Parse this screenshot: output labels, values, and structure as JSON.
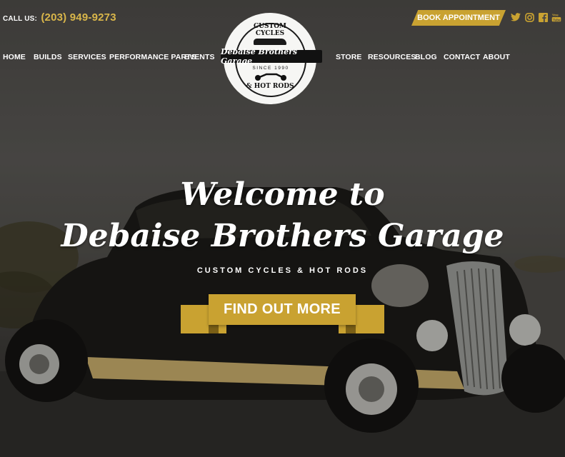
{
  "header": {
    "call_label": "CALL US:",
    "phone": "(203) 949-9273",
    "book_button": "BOOK APPOINTMENT",
    "social": [
      {
        "icon": "twitter-icon",
        "glyph": "🐦"
      },
      {
        "icon": "instagram-icon",
        "glyph": "◎"
      },
      {
        "icon": "facebook-icon",
        "glyph": "f"
      },
      {
        "icon": "youtube-icon",
        "glyph": "▶"
      }
    ]
  },
  "nav": {
    "left": [
      "HOME",
      "BUILDS",
      "SERVICES",
      "PERFORMANCE PARTS",
      "EVENTS"
    ],
    "right": [
      "STORE",
      "RESOURCES",
      "BLOG",
      "CONTACT",
      "ABOUT"
    ]
  },
  "logo": {
    "top": "CUSTOM CYCLES",
    "banner": "Debaise Brothers Garage",
    "since": "SINCE 1990",
    "bottom": "& HOT RODS"
  },
  "hero": {
    "title_line1": "Welcome to",
    "title_line2": "Debaise Brothers Garage",
    "tagline": "CUSTOM CYCLES & HOT RODS",
    "cta": "FIND OUT MORE"
  },
  "colors": {
    "accent": "#c9a231",
    "phone": "#d9b64a",
    "text": "#ffffff"
  }
}
